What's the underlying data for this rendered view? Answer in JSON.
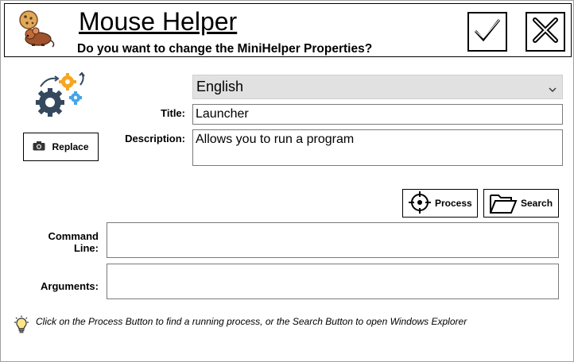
{
  "header": {
    "title": "Mouse Helper",
    "subtitle": "Do you want to change the MiniHelper Properties?",
    "logo_icon": "mouse-cookie-icon",
    "ok_icon": "checkmark-icon",
    "close_icon": "close-icon"
  },
  "form": {
    "language": "English",
    "title_label": "Title:",
    "title_value": "Launcher",
    "description_label": "Description:",
    "description_value": "Allows you to run a program",
    "command_line_label_1": "Command",
    "command_line_label_2": "Line:",
    "command_line_value": "",
    "arguments_label": "Arguments:",
    "arguments_value": ""
  },
  "buttons": {
    "replace_label": "Replace",
    "process_label": "Process",
    "search_label": "Search"
  },
  "hint": {
    "icon": "lightbulb-icon",
    "text": "Click on the Process Button to find a running process, or the Search Button to  open Windows Explorer"
  },
  "colors": {
    "gear_orange": "#f5a623",
    "gear_blue": "#42a5e8",
    "gear_dark": "#34495e",
    "select_bg": "#e1e1e1"
  }
}
